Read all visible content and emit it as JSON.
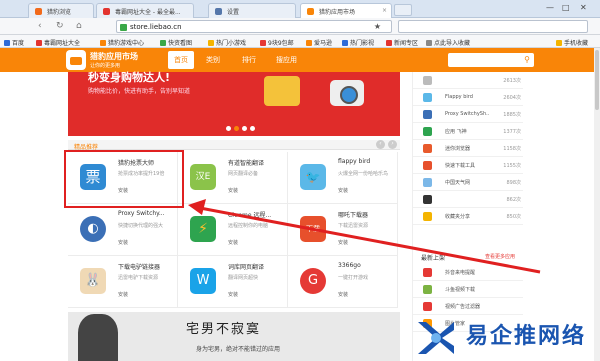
{
  "tabs": [
    {
      "label": "猎豹浏览",
      "color": "#f26a1b",
      "active": false
    },
    {
      "label": "毒霸网址大全 - 最全最...",
      "color": "#e3342f",
      "active": false
    },
    {
      "label": "设置",
      "color": "#5577aa",
      "active": false
    },
    {
      "label": "猎豹应用市场",
      "color": "#f98508",
      "active": true
    }
  ],
  "url": "store.liebao.cn",
  "bookmarks": [
    "百度",
    "毒霸网址大全",
    "猎豹游戏中心",
    "快资看图",
    "热门小游戏",
    "9块9包邮",
    "爱马逊",
    "热门影视",
    "新闻专区",
    "点此导入收藏"
  ],
  "bookmarks_right": "手机收藏",
  "header": {
    "brand": "猎豹应用市场",
    "brand_sub": "让你的更多用",
    "nav": [
      "首页",
      "类别",
      "排行",
      "搜应用"
    ],
    "active": 0,
    "search_icon": "search-icon"
  },
  "banner": {
    "title": "秒变身购物达人!",
    "sub": "购物能比价，快进有助手，告别早知道"
  },
  "section_title": "精品推荐",
  "apps": [
    {
      "name": "猎豹抢票大师",
      "desc": "抢票成功率提升19倍",
      "install": "安装",
      "color": "#2f8ad3",
      "glyph": "票"
    },
    {
      "name": "有道智能翻译",
      "desc": "网页翻译必备",
      "install": "安装",
      "color": "#8bc34a",
      "glyph": "汉E"
    },
    {
      "name": "flappy bird",
      "desc": "火爆全网一份哈哈乐鸟",
      "install": "安装",
      "color": "#5bb8e8",
      "glyph": "🐦"
    },
    {
      "name": "Proxy Switchy...",
      "desc": "快捷切换代理的强大",
      "install": "安装",
      "color": "#3b6fb6",
      "glyph": "◐"
    },
    {
      "name": "Chrome 远程...",
      "desc": "远程控制你的电脑",
      "install": "安装",
      "color": "#2ea44f",
      "glyph": "⚡"
    },
    {
      "name": "哪吒下载器",
      "desc": "下载迅雷资源",
      "install": "安装",
      "color": "#e7502c",
      "glyph": "下载"
    },
    {
      "name": "下载电驴链接器",
      "desc": "迅雷电驴下载资源",
      "install": "安装",
      "color": "#f0d9b5",
      "glyph": "🐰"
    },
    {
      "name": "词库网页翻译",
      "desc": "翻译网页超快",
      "install": "安装",
      "color": "#1aa3e8",
      "glyph": "W"
    },
    {
      "name": "3366go",
      "desc": "一键打开游戏",
      "install": "安装",
      "color": "#e53935",
      "glyph": "G"
    }
  ],
  "promo": {
    "title": "宅男不寂寞",
    "sub": "身为宅男，绝对不能错过的应用"
  },
  "ranking": [
    {
      "name": "",
      "count": "2613次",
      "color": "#bbb"
    },
    {
      "name": "Flappy bird",
      "count": "2604次",
      "color": "#5bb8e8"
    },
    {
      "name": "Proxy SwitchySh...",
      "count": "1885次",
      "color": "#3b6fb6"
    },
    {
      "name": "应用 飞神",
      "count": "1377次",
      "color": "#2ea44f"
    },
    {
      "name": "迷你浏览器",
      "count": "1158次",
      "color": "#e85a2c"
    },
    {
      "name": "快速下载工具",
      "count": "1155次",
      "color": "#e7502c"
    },
    {
      "name": "中国天气网",
      "count": "898次",
      "color": "#7cb8e8"
    },
    {
      "name": "",
      "count": "862次",
      "color": "#333"
    },
    {
      "name": "收藏夹分享",
      "count": "850次",
      "color": "#f4b400"
    }
  ],
  "new_section": {
    "title": "最新上架",
    "more": "查看更多应用"
  },
  "new_apps": [
    {
      "name": "抖音来电提醒",
      "color": "#e53935"
    },
    {
      "name": "斗鱼视频下载",
      "color": "#7cb342"
    },
    {
      "name": "视频广告过滤器",
      "color": "#e53935"
    },
    {
      "name": "图片管家",
      "color": "#ff9800"
    }
  ],
  "watermark": "易企推网络"
}
